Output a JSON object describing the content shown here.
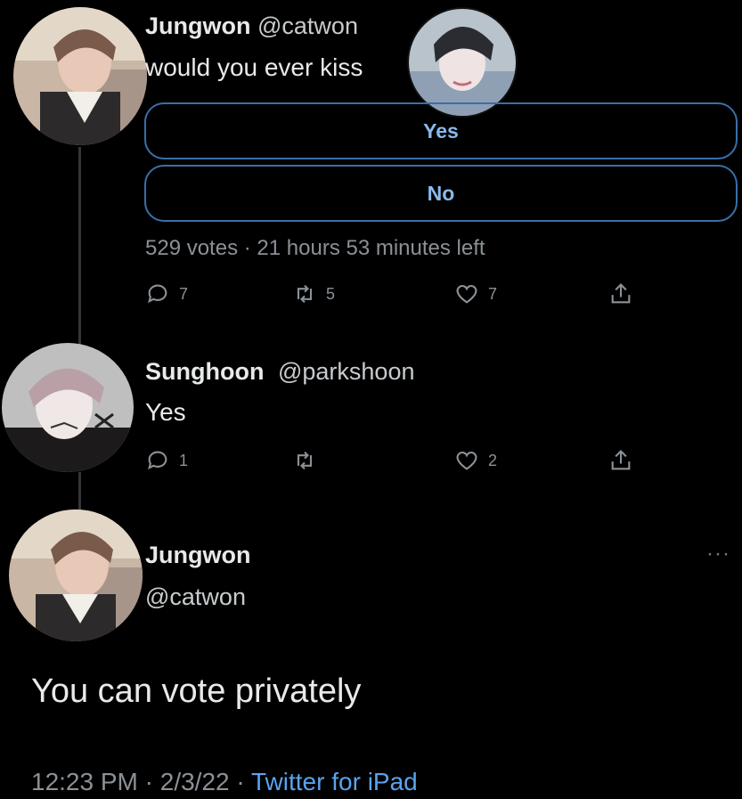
{
  "tweet1": {
    "display_name": "Jungwon",
    "handle": "@catwon",
    "text": "would you ever kiss",
    "poll": {
      "options": [
        "Yes",
        "No"
      ],
      "votes": "529 votes",
      "separator": "·",
      "time_left": "21 hours 53 minutes left"
    },
    "actions": {
      "reply_count": "7",
      "retweet_count": "5",
      "like_count": "7"
    }
  },
  "reply": {
    "display_name": "Sunghoon",
    "handle": "@parkshoon",
    "text": "Yes",
    "actions": {
      "reply_count": "1",
      "retweet_count": "",
      "like_count": "2"
    }
  },
  "main_tweet": {
    "display_name": "Jungwon",
    "handle": "@catwon",
    "text": "You can vote privately",
    "time": "12:23 PM",
    "separator": "·",
    "date": "2/3/22",
    "source": "Twitter for iPad",
    "more_icon": "more-horizontal-icon"
  },
  "colors": {
    "background": "#000000",
    "poll_border": "#3a6fa8",
    "poll_text": "#8bb9ea",
    "link": "#5aa3ee",
    "secondary_text": "#8b9197"
  }
}
